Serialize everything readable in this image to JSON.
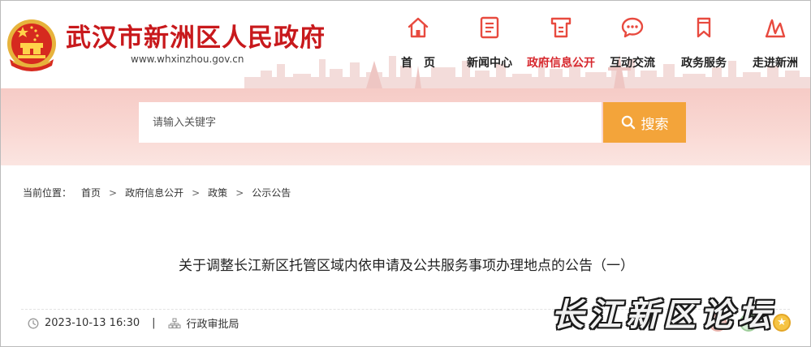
{
  "header": {
    "site_title": "武汉市新洲区人民政府",
    "site_url": "www.whxinzhou.gov.cn",
    "nav": [
      {
        "label": "首　页",
        "icon": "home-icon"
      },
      {
        "label": "新闻中心",
        "icon": "news-icon"
      },
      {
        "label": "政府信息公开",
        "icon": "info-disclosure-icon",
        "active": true
      },
      {
        "label": "互动交流",
        "icon": "chat-icon"
      },
      {
        "label": "政务服务",
        "icon": "bookmark-icon"
      },
      {
        "label": "走进新洲",
        "icon": "landmark-icon"
      }
    ]
  },
  "search": {
    "placeholder": "请输入关键字",
    "button_label": "搜索"
  },
  "breadcrumb": {
    "prefix": "当前位置：",
    "items": [
      "首页",
      "政府信息公开",
      "政策",
      "公示公告"
    ]
  },
  "article": {
    "title": "关于调整长江新区托管区域内依申请及公共服务事项办理地点的公告（一）",
    "date": "2023-10-13 16:30",
    "separator": "|",
    "source": "行政审批局"
  },
  "watermark": {
    "text": "长江新区论坛"
  },
  "colors": {
    "brand_red": "#c8191c",
    "active_nav": "#d7282e",
    "search_button": "#f3a43a",
    "band": "#f8d2cd"
  }
}
